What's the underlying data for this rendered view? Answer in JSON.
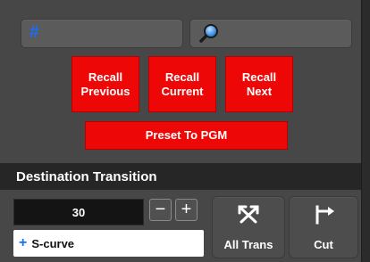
{
  "top_bar": {
    "hash_symbol": "#",
    "search_icon": "search-icon"
  },
  "recall": {
    "previous_label": "Recall\nPrevious",
    "current_label": "Recall\nCurrent",
    "next_label": "Recall\nNext",
    "preset_label": "Preset To PGM"
  },
  "destination": {
    "title": "Destination Transition",
    "rate_value": "30",
    "minus_label": "−",
    "plus_label": "+",
    "curve_plus": "+",
    "curve_label": "S-curve",
    "all_trans_label": "All Trans",
    "all_trans_icon": "crossed-arrows-icon",
    "cut_label": "Cut",
    "cut_icon": "cut-arrow-icon"
  },
  "colors": {
    "accent_red": "#ee0707",
    "accent_blue": "#1a6cff",
    "panel_bg": "#474747",
    "header_bg": "#262626"
  }
}
